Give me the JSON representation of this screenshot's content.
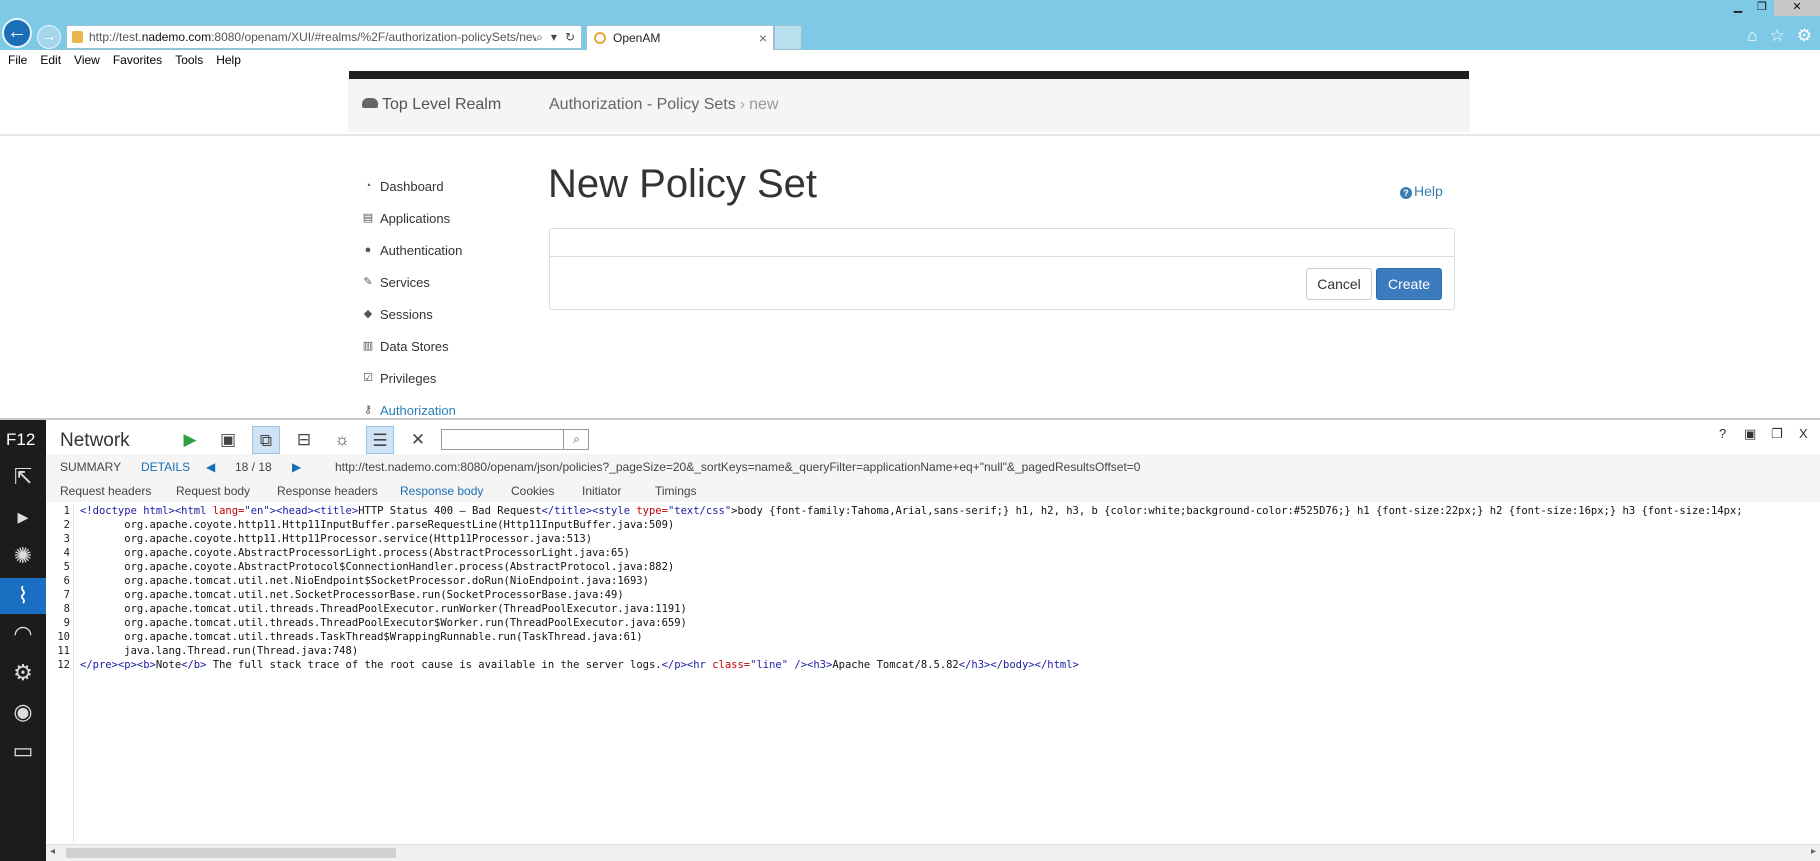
{
  "browser": {
    "url_prefix": "http://test.",
    "url_host": "nademo.com",
    "url_suffix": ":8080/openam/XUI/#realms/%2F/authorization-policySets/new",
    "tab_title": "OpenAM",
    "menu": [
      "File",
      "Edit",
      "View",
      "Favorites",
      "Tools",
      "Help"
    ]
  },
  "app": {
    "realm": "Top Level Realm",
    "breadcrumb": [
      "Authorization - Policy Sets",
      "new"
    ],
    "page_title": "New Policy Set",
    "help_label": "Help",
    "cancel_label": "Cancel",
    "create_label": "Create",
    "nav": [
      {
        "label": "Dashboard",
        "icon": "dashboard-icon"
      },
      {
        "label": "Applications",
        "icon": "applications-icon"
      },
      {
        "label": "Authentication",
        "icon": "user-icon"
      },
      {
        "label": "Services",
        "icon": "wrench-icon"
      },
      {
        "label": "Sessions",
        "icon": "tag-icon"
      },
      {
        "label": "Data Stores",
        "icon": "database-icon"
      },
      {
        "label": "Privileges",
        "icon": "checkbox-icon"
      },
      {
        "label": "Authorization",
        "icon": "key-icon",
        "active": true
      }
    ]
  },
  "devtools": {
    "f12_label": "F12",
    "tool_title": "Network",
    "summary_label": "SUMMARY",
    "details_label": "DETAILS",
    "count": "18 / 18",
    "request_url": "http://test.nademo.com:8080/openam/json/policies?_pageSize=20&_sortKeys=name&_queryFilter=applicationName+eq+\"null\"&_pagedResultsOffset=0",
    "tabs": [
      "Request headers",
      "Request body",
      "Response headers",
      "Response body",
      "Cookies",
      "Initiator",
      "Timings"
    ],
    "selected_tab": "Response body",
    "corner": [
      "?",
      "X"
    ],
    "line_numbers": [
      "1",
      "2",
      "3",
      "4",
      "5",
      "6",
      "7",
      "8",
      "9",
      "10",
      "11",
      "12"
    ],
    "code": {
      "l1_doctype": "<!doctype html>",
      "l1_html": "<html ",
      "l1_lang_attr": "lang=",
      "l1_lang_val": "\"en\"",
      "l1_head": "><head><title>",
      "l1_title": "HTTP Status 400 – Bad Request",
      "l1_title_close": "</title><style ",
      "l1_type_attr": "type=",
      "l1_type_val": "\"text/css\"",
      "l1_css": ">body {font-family:Tahoma,Arial,sans-serif;} h1, h2, h3, b {color:white;background-color:#525D76;} h1 {font-size:22px;} h2 {font-size:16px;} h3 {font-size:14px;",
      "l2": "       org.apache.coyote.http11.Http11InputBuffer.parseRequestLine(Http11InputBuffer.java:509)",
      "l3": "       org.apache.coyote.http11.Http11Processor.service(Http11Processor.java:513)",
      "l4": "       org.apache.coyote.AbstractProcessorLight.process(AbstractProcessorLight.java:65)",
      "l5": "       org.apache.coyote.AbstractProtocol$ConnectionHandler.process(AbstractProtocol.java:882)",
      "l6": "       org.apache.tomcat.util.net.NioEndpoint$SocketProcessor.doRun(NioEndpoint.java:1693)",
      "l7": "       org.apache.tomcat.util.net.SocketProcessorBase.run(SocketProcessorBase.java:49)",
      "l8": "       org.apache.tomcat.util.threads.ThreadPoolExecutor.runWorker(ThreadPoolExecutor.java:1191)",
      "l9": "       org.apache.tomcat.util.threads.ThreadPoolExecutor$Worker.run(ThreadPoolExecutor.java:659)",
      "l10": "       org.apache.tomcat.util.threads.TaskThread$WrappingRunnable.run(TaskThread.java:61)",
      "l11": "       java.lang.Thread.run(Thread.java:748)",
      "l12_tags": "</pre><p><b>",
      "l12_note": "Note",
      "l12_b_close": "</b>",
      "l12_text": " The full stack trace of the root cause is available in the server logs.",
      "l12_p_hr": "</p><hr ",
      "l12_class_attr": "class=",
      "l12_class_val": "\"line\"",
      "l12_h3_open": " /><h3>",
      "l12_h3_text": "Apache Tomcat/8.5.82",
      "l12_end": "</h3></body></html>"
    }
  },
  "colors": {
    "chrome_bg": "#7ec9e6",
    "primary_button": "#3c7bbd",
    "link": "#1a6fb8",
    "devtools_rail": "#1c1c1c",
    "active_rail": "#1a6fc2"
  }
}
